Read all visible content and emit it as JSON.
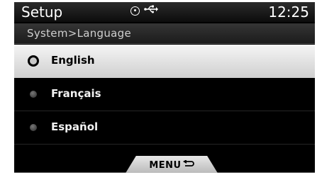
{
  "header": {
    "title": "Setup",
    "clock": "12:25",
    "icons": [
      "disc-icon",
      "usb-icon"
    ]
  },
  "breadcrumb": "System>Language",
  "languages": [
    {
      "label": "English",
      "selected": true
    },
    {
      "label": "Français",
      "selected": false
    },
    {
      "label": "Español",
      "selected": false
    }
  ],
  "footer": {
    "menu_label": "MENU",
    "menu_icon": "back-arrow-icon"
  }
}
